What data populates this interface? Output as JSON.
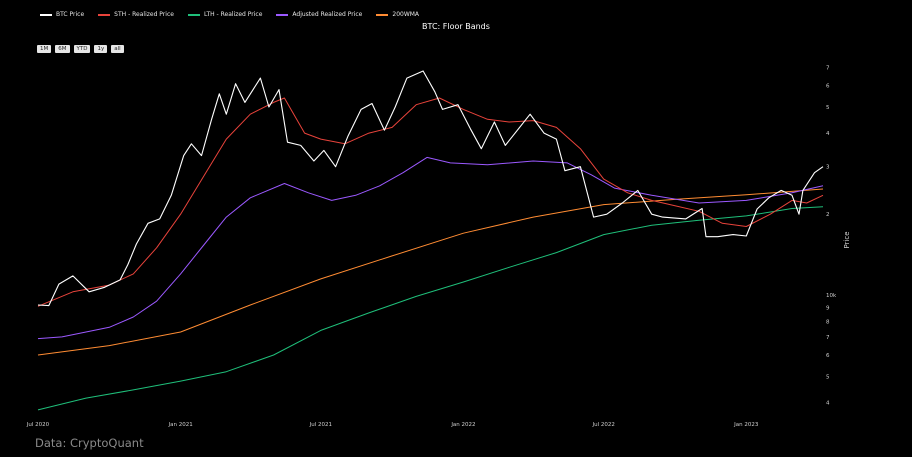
{
  "legend": {
    "items": [
      {
        "label": "BTC Price",
        "color": "#ffffff"
      },
      {
        "label": "STH - Realized Price",
        "color": "#e8433b"
      },
      {
        "label": "LTH - Realized Price",
        "color": "#1fbf7a"
      },
      {
        "label": "Adjusted Realized Price",
        "color": "#9b59ff"
      },
      {
        "label": "200WMA",
        "color": "#ff8c33"
      }
    ]
  },
  "title": "BTC: Floor Bands",
  "range_buttons": [
    "1M",
    "6M",
    "YTD",
    "1y",
    "all"
  ],
  "source": "Data: CryptoQuant",
  "chart_data": {
    "type": "line",
    "title": "BTC: Floor Bands",
    "ylabel": "Price",
    "yscale": "log",
    "ylim": [
      3500,
      78000
    ],
    "xlim": [
      "2020-07-01",
      "2023-04-10"
    ],
    "x_ticks": [
      {
        "date": "2020-07-01",
        "label": "Jul 2020"
      },
      {
        "date": "2021-01-01",
        "label": "Jan 2021"
      },
      {
        "date": "2021-07-01",
        "label": "Jul 2021"
      },
      {
        "date": "2022-01-01",
        "label": "Jan 2022"
      },
      {
        "date": "2022-07-01",
        "label": "Jul 2022"
      },
      {
        "date": "2023-01-01",
        "label": "Jan 2023"
      }
    ],
    "y_ticks": [
      {
        "value": 4000,
        "label": "4"
      },
      {
        "value": 5000,
        "label": "5"
      },
      {
        "value": 6000,
        "label": "6"
      },
      {
        "value": 7000,
        "label": "7"
      },
      {
        "value": 8000,
        "label": "8"
      },
      {
        "value": 9000,
        "label": "9"
      },
      {
        "value": 10000,
        "label": "10k"
      },
      {
        "value": 20000,
        "label": "2"
      },
      {
        "value": 30000,
        "label": "3"
      },
      {
        "value": 40000,
        "label": "4"
      },
      {
        "value": 50000,
        "label": "5"
      },
      {
        "value": 60000,
        "label": "6"
      },
      {
        "value": 70000,
        "label": "7"
      }
    ],
    "grid": false,
    "legend_position": "top-left",
    "series": [
      {
        "name": "BTC Price",
        "color": "#ffffff",
        "width": 1.1,
        "points": [
          [
            "2020-07-01",
            9200
          ],
          [
            "2020-07-15",
            9150
          ],
          [
            "2020-07-28",
            11000
          ],
          [
            "2020-08-15",
            11800
          ],
          [
            "2020-09-05",
            10300
          ],
          [
            "2020-09-25",
            10700
          ],
          [
            "2020-10-15",
            11400
          ],
          [
            "2020-10-25",
            13000
          ],
          [
            "2020-11-05",
            15500
          ],
          [
            "2020-11-20",
            18500
          ],
          [
            "2020-12-05",
            19200
          ],
          [
            "2020-12-20",
            23500
          ],
          [
            "2021-01-05",
            33000
          ],
          [
            "2021-01-15",
            36500
          ],
          [
            "2021-01-28",
            33000
          ],
          [
            "2021-02-10",
            45000
          ],
          [
            "2021-02-20",
            56000
          ],
          [
            "2021-03-01",
            47000
          ],
          [
            "2021-03-13",
            61000
          ],
          [
            "2021-03-25",
            52000
          ],
          [
            "2021-04-14",
            64000
          ],
          [
            "2021-04-25",
            50000
          ],
          [
            "2021-05-08",
            58000
          ],
          [
            "2021-05-19",
            37000
          ],
          [
            "2021-06-05",
            36000
          ],
          [
            "2021-06-22",
            31500
          ],
          [
            "2021-07-05",
            34500
          ],
          [
            "2021-07-20",
            30000
          ],
          [
            "2021-08-05",
            39000
          ],
          [
            "2021-08-22",
            49000
          ],
          [
            "2021-09-05",
            51500
          ],
          [
            "2021-09-21",
            41000
          ],
          [
            "2021-10-05",
            50000
          ],
          [
            "2021-10-20",
            64000
          ],
          [
            "2021-11-10",
            68000
          ],
          [
            "2021-11-25",
            57000
          ],
          [
            "2021-12-05",
            49000
          ],
          [
            "2021-12-25",
            51000
          ],
          [
            "2022-01-10",
            41500
          ],
          [
            "2022-01-24",
            35000
          ],
          [
            "2022-02-10",
            44000
          ],
          [
            "2022-02-24",
            36000
          ],
          [
            "2022-03-28",
            47000
          ],
          [
            "2022-04-15",
            40000
          ],
          [
            "2022-05-01",
            38000
          ],
          [
            "2022-05-12",
            29000
          ],
          [
            "2022-06-01",
            30000
          ],
          [
            "2022-06-18",
            19500
          ],
          [
            "2022-07-05",
            20000
          ],
          [
            "2022-07-25",
            22000
          ],
          [
            "2022-08-14",
            24500
          ],
          [
            "2022-09-01",
            20000
          ],
          [
            "2022-09-15",
            19500
          ],
          [
            "2022-10-15",
            19200
          ],
          [
            "2022-11-05",
            21000
          ],
          [
            "2022-11-10",
            16500
          ],
          [
            "2022-11-25",
            16500
          ],
          [
            "2022-12-15",
            16800
          ],
          [
            "2023-01-01",
            16600
          ],
          [
            "2023-01-15",
            20900
          ],
          [
            "2023-01-30",
            23000
          ],
          [
            "2023-02-15",
            24500
          ],
          [
            "2023-03-01",
            23500
          ],
          [
            "2023-03-10",
            20000
          ],
          [
            "2023-03-15",
            24500
          ],
          [
            "2023-03-30",
            28500
          ],
          [
            "2023-04-10",
            30000
          ]
        ]
      },
      {
        "name": "STH - Realized Price",
        "color": "#e8433b",
        "width": 1,
        "points": [
          [
            "2020-07-01",
            9100
          ],
          [
            "2020-08-15",
            10300
          ],
          [
            "2020-10-01",
            10900
          ],
          [
            "2020-11-01",
            12000
          ],
          [
            "2020-12-01",
            15000
          ],
          [
            "2021-01-01",
            20000
          ],
          [
            "2021-02-01",
            28000
          ],
          [
            "2021-03-01",
            38000
          ],
          [
            "2021-04-01",
            47000
          ],
          [
            "2021-05-01",
            52000
          ],
          [
            "2021-05-15",
            54000
          ],
          [
            "2021-06-10",
            40000
          ],
          [
            "2021-07-01",
            38000
          ],
          [
            "2021-08-01",
            36500
          ],
          [
            "2021-09-01",
            40000
          ],
          [
            "2021-10-01",
            42000
          ],
          [
            "2021-11-01",
            51000
          ],
          [
            "2021-12-01",
            54000
          ],
          [
            "2022-01-01",
            49000
          ],
          [
            "2022-02-01",
            45000
          ],
          [
            "2022-03-01",
            44000
          ],
          [
            "2022-04-01",
            44500
          ],
          [
            "2022-05-01",
            42000
          ],
          [
            "2022-06-01",
            35000
          ],
          [
            "2022-07-01",
            27000
          ],
          [
            "2022-08-01",
            24000
          ],
          [
            "2022-09-01",
            22500
          ],
          [
            "2022-10-01",
            21500
          ],
          [
            "2022-11-01",
            20500
          ],
          [
            "2022-12-01",
            18500
          ],
          [
            "2023-01-01",
            18000
          ],
          [
            "2023-02-01",
            20000
          ],
          [
            "2023-03-01",
            22500
          ],
          [
            "2023-03-20",
            22000
          ],
          [
            "2023-04-10",
            23500
          ]
        ]
      },
      {
        "name": "LTH - Realized Price",
        "color": "#1fbf7a",
        "width": 1,
        "points": [
          [
            "2020-07-01",
            3750
          ],
          [
            "2020-09-01",
            4150
          ],
          [
            "2020-11-01",
            4450
          ],
          [
            "2021-01-01",
            4800
          ],
          [
            "2021-03-01",
            5200
          ],
          [
            "2021-05-01",
            6000
          ],
          [
            "2021-07-01",
            7400
          ],
          [
            "2021-09-01",
            8600
          ],
          [
            "2021-11-01",
            9900
          ],
          [
            "2022-01-01",
            11200
          ],
          [
            "2022-03-01",
            12700
          ],
          [
            "2022-05-01",
            14400
          ],
          [
            "2022-07-01",
            16800
          ],
          [
            "2022-09-01",
            18200
          ],
          [
            "2022-11-01",
            19000
          ],
          [
            "2023-01-01",
            19700
          ],
          [
            "2023-03-01",
            21000
          ],
          [
            "2023-04-10",
            21300
          ]
        ]
      },
      {
        "name": "Adjusted Realized Price",
        "color": "#9b59ff",
        "width": 1,
        "points": [
          [
            "2020-07-01",
            6900
          ],
          [
            "2020-08-01",
            7000
          ],
          [
            "2020-09-01",
            7300
          ],
          [
            "2020-10-01",
            7600
          ],
          [
            "2020-11-01",
            8300
          ],
          [
            "2020-12-01",
            9500
          ],
          [
            "2021-01-01",
            12000
          ],
          [
            "2021-02-01",
            15500
          ],
          [
            "2021-03-01",
            19500
          ],
          [
            "2021-04-01",
            23000
          ],
          [
            "2021-05-15",
            26000
          ],
          [
            "2021-06-15",
            24000
          ],
          [
            "2021-07-15",
            22500
          ],
          [
            "2021-08-15",
            23500
          ],
          [
            "2021-09-15",
            25500
          ],
          [
            "2021-10-15",
            28500
          ],
          [
            "2021-11-15",
            32500
          ],
          [
            "2021-12-15",
            31000
          ],
          [
            "2022-02-01",
            30500
          ],
          [
            "2022-04-01",
            31500
          ],
          [
            "2022-05-15",
            31000
          ],
          [
            "2022-06-15",
            28000
          ],
          [
            "2022-07-15",
            25000
          ],
          [
            "2022-09-01",
            23500
          ],
          [
            "2022-11-01",
            22000
          ],
          [
            "2023-01-01",
            22500
          ],
          [
            "2023-03-01",
            24000
          ],
          [
            "2023-04-10",
            25500
          ]
        ]
      },
      {
        "name": "200WMA",
        "color": "#ff8c33",
        "width": 1,
        "points": [
          [
            "2020-07-01",
            6000
          ],
          [
            "2020-10-01",
            6500
          ],
          [
            "2021-01-01",
            7300
          ],
          [
            "2021-04-01",
            9200
          ],
          [
            "2021-07-01",
            11500
          ],
          [
            "2021-10-01",
            14000
          ],
          [
            "2022-01-01",
            17000
          ],
          [
            "2022-04-01",
            19500
          ],
          [
            "2022-07-01",
            21700
          ],
          [
            "2022-10-01",
            22700
          ],
          [
            "2023-01-01",
            23600
          ],
          [
            "2023-04-10",
            24800
          ]
        ]
      }
    ]
  }
}
